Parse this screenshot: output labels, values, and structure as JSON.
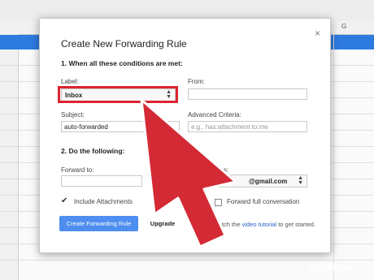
{
  "dialog": {
    "title": "Create New Forwarding Rule",
    "close_glyph": "×",
    "section1": "1. When all these conditions are met:",
    "label_caption": "Label:",
    "label_value": "Inbox",
    "from_caption": "From:",
    "from_value": "",
    "subject_caption": "Subject:",
    "subject_value": "auto-forwarded",
    "advanced_caption": "Advanced Criteria:",
    "advanced_placeholder": "e.g., has:attachment to:me",
    "section2": "2. Do the following:",
    "forward_to_caption": "Forward to:",
    "forward_to_value": "",
    "alias_caption": "lias:",
    "alias_value": "@gmail.com",
    "include_attachments": "Include Attachments",
    "forward_full": "Forward full conversation",
    "create_button": "Create Forwarding Rule",
    "upgrade_button": "Upgrade",
    "hint_prefix": "Watch the ",
    "hint_link": "video tutorial",
    "hint_suffix": " to get started."
  },
  "sheet": {
    "column_g": "G"
  },
  "watermark": {
    "wiki": "wiki",
    "how": "How"
  },
  "colors": {
    "highlight": "#d9262f",
    "arrow": "#d42a35",
    "primary": "#4d8ef0",
    "sheet_blue": "#2d7be0"
  },
  "icons": [
    "close-icon",
    "select-arrows-icon",
    "checkmark-icon",
    "pointer-arrow-icon"
  ]
}
